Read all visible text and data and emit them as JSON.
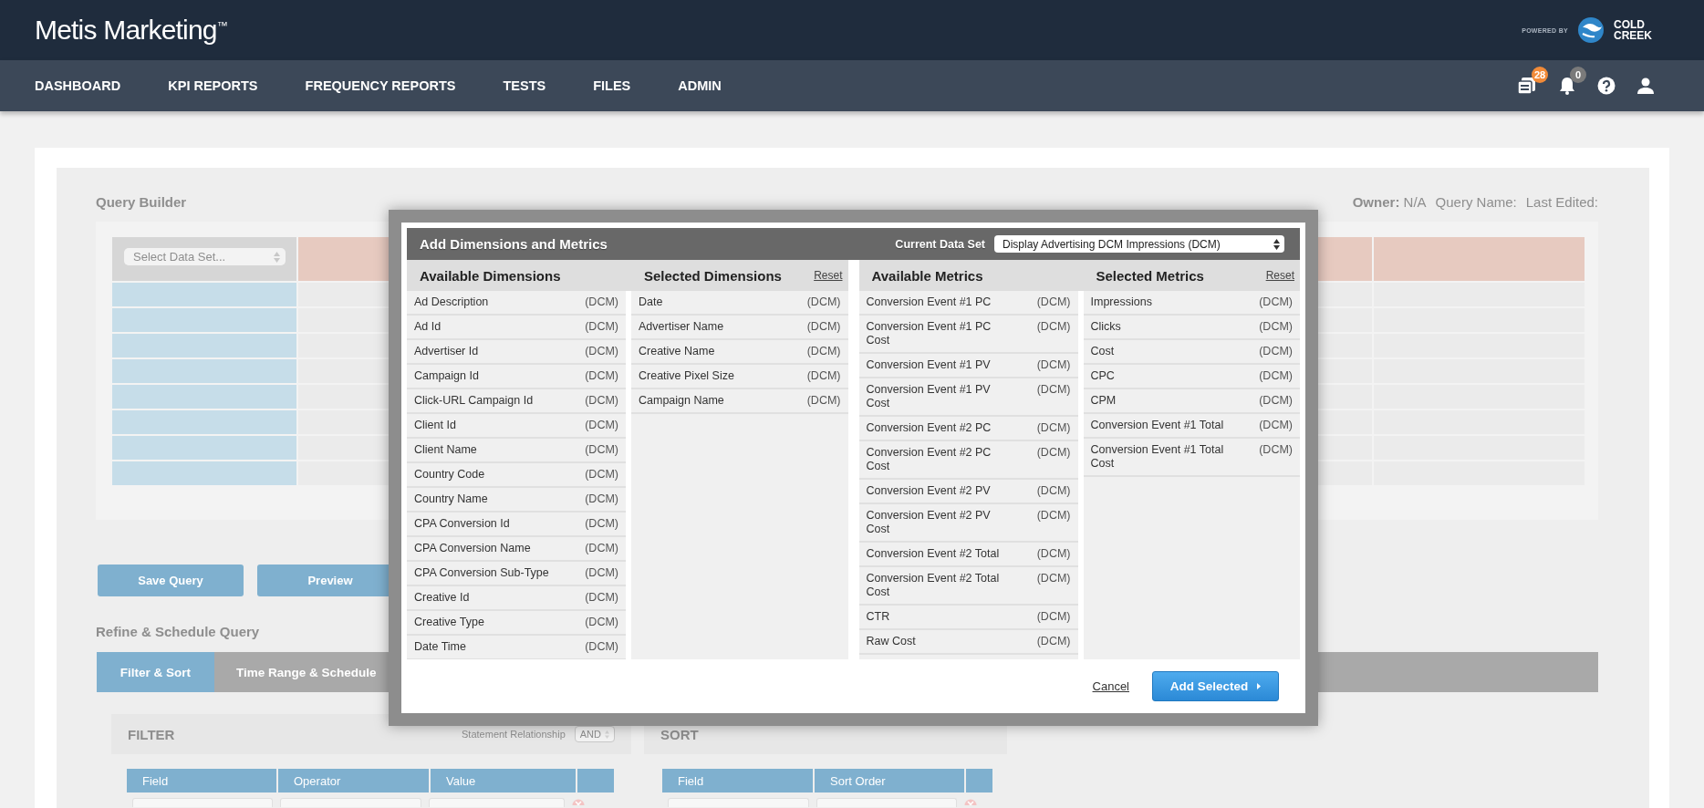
{
  "header": {
    "logo": "Metis Marketing$^{™}$",
    "powered_by": "POWERED BY",
    "partner": "COLD CREEK"
  },
  "nav": [
    {
      "label": "DASHBOARD"
    },
    {
      "label": "KPI REPORTS"
    },
    {
      "label": "FREQUENCY REPORTS"
    },
    {
      "label": "TESTS"
    },
    {
      "label": "FILES"
    },
    {
      "label": "ADMIN"
    }
  ],
  "nav_icons": [
    {
      "kind": "documents",
      "badge": "28",
      "color": "#f28b38"
    },
    {
      "kind": "bell",
      "badge": "0",
      "color": "#7a7a7a"
    },
    {
      "kind": "help"
    },
    {
      "kind": "user"
    }
  ],
  "query_builder": {
    "title": "Query Builder",
    "meta": [
      "**Owner:** N/A",
      "Query Name:",
      "Last Edited:"
    ],
    "data_set_select": {
      "placeholder": "Select Data Set..."
    }
  },
  "buttons": [
    "Save Query",
    "Preview"
  ],
  "refine": {
    "title": "Refine & Schedule Query",
    "tabs": [
      {
        "label": "Filter & Sort",
        "selected": true
      },
      {
        "label": "Time Range & Schedule",
        "selected": false
      }
    ],
    "filter": {
      "title": "FILTER",
      "relationship_label": "Statement Relationship",
      "relationship_value": "AND",
      "columns": [
        "Field",
        "Operator",
        "Value"
      ]
    },
    "sort": {
      "title": "SORT",
      "columns": [
        "Field",
        "Sort Order"
      ]
    }
  },
  "dialog": {
    "title": "Add Dimensions and Metrics",
    "data_set_label": "Current Data Set",
    "data_set_value": "Display Advertising DCM Impressions (DCM)",
    "sections": [
      {
        "columns": [
          {
            "title": "Available Dimensions",
            "items": [
              {
                "name": "Ad Description",
                "source": "(DCM)"
              },
              {
                "name": "Ad Id",
                "source": "(DCM)"
              },
              {
                "name": "Advertiser Id",
                "source": "(DCM)"
              },
              {
                "name": "Campaign Id",
                "source": "(DCM)"
              },
              {
                "name": "Click-URL Campaign Id",
                "source": "(DCM)"
              },
              {
                "name": "Client Id",
                "source": "(DCM)"
              },
              {
                "name": "Client Name",
                "source": "(DCM)"
              },
              {
                "name": "Country Code",
                "source": "(DCM)"
              },
              {
                "name": "Country Name",
                "source": "(DCM)"
              },
              {
                "name": "CPA Conversion Id",
                "source": "(DCM)"
              },
              {
                "name": "CPA Conversion Name",
                "source": "(DCM)"
              },
              {
                "name": "CPA Conversion Sub-Type",
                "source": "(DCM)"
              },
              {
                "name": "Creative Id",
                "source": "(DCM)"
              },
              {
                "name": "Creative Type",
                "source": "(DCM)"
              },
              {
                "name": "Date Time",
                "source": "(DCM)"
              }
            ]
          },
          {
            "title": "Selected Dimensions",
            "reset": "Reset",
            "items": [
              {
                "name": "Date",
                "source": "(DCM)"
              },
              {
                "name": "Advertiser Name",
                "source": "(DCM)"
              },
              {
                "name": "Creative Name",
                "source": "(DCM)"
              },
              {
                "name": "Creative Pixel Size",
                "source": "(DCM)"
              },
              {
                "name": "Campaign Name",
                "source": "(DCM)"
              }
            ]
          }
        ]
      },
      {
        "columns": [
          {
            "title": "Available Metrics",
            "items": [
              {
                "name": "Conversion Event #1 PC",
                "source": "(DCM)"
              },
              {
                "name": "Conversion Event #1 PC Cost",
                "source": "(DCM)"
              },
              {
                "name": "Conversion Event #1 PV",
                "source": "(DCM)"
              },
              {
                "name": "Conversion Event #1 PV Cost",
                "source": "(DCM)"
              },
              {
                "name": "Conversion Event #2 PC",
                "source": "(DCM)"
              },
              {
                "name": "Conversion Event #2 PC Cost",
                "source": "(DCM)"
              },
              {
                "name": "Conversion Event #2 PV",
                "source": "(DCM)"
              },
              {
                "name": "Conversion Event #2 PV Cost",
                "source": "(DCM)"
              },
              {
                "name": "Conversion Event #2 Total",
                "source": "(DCM)"
              },
              {
                "name": "Conversion Event #2 Total Cost",
                "source": "(DCM)"
              },
              {
                "name": "CTR",
                "source": "(DCM)"
              },
              {
                "name": "Raw Cost",
                "source": "(DCM)"
              }
            ]
          },
          {
            "title": "Selected Metrics",
            "reset": "Reset",
            "items": [
              {
                "name": "Impressions",
                "source": "(DCM)"
              },
              {
                "name": "Clicks",
                "source": "(DCM)"
              },
              {
                "name": "Cost",
                "source": "(DCM)"
              },
              {
                "name": "CPC",
                "source": "(DCM)"
              },
              {
                "name": "CPM",
                "source": "(DCM)"
              },
              {
                "name": "Conversion Event #1 Total",
                "source": "(DCM)"
              },
              {
                "name": "Conversion Event #1 Total Cost",
                "source": "(DCM)"
              }
            ]
          }
        ]
      }
    ],
    "cancel": "Cancel",
    "submit": "Add Selected"
  }
}
